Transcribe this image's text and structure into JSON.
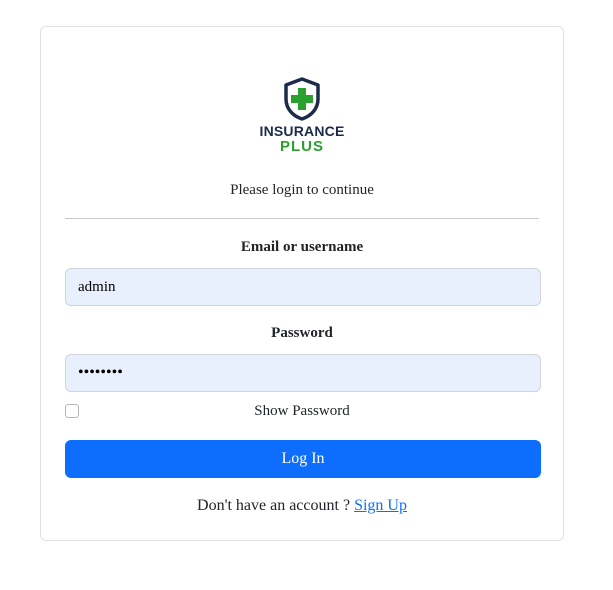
{
  "brand": {
    "icon": "shield-plus-icon",
    "line1": "INSURANCE",
    "line2": "PLUS",
    "colors": {
      "navy": "#1c2b4a",
      "green": "#2aa12e"
    }
  },
  "login": {
    "subtitle": "Please login to continue",
    "email_label": "Email or username",
    "email_value": "admin",
    "password_label": "Password",
    "password_value": "admin123",
    "show_password_label": "Show Password",
    "show_password_checked": false,
    "submit_label": "Log In",
    "signup_prompt": "Don't have an account ?",
    "signup_link": "Sign Up"
  },
  "colors": {
    "primary": "#0d6efd",
    "field_background": "#e8f0fe"
  }
}
